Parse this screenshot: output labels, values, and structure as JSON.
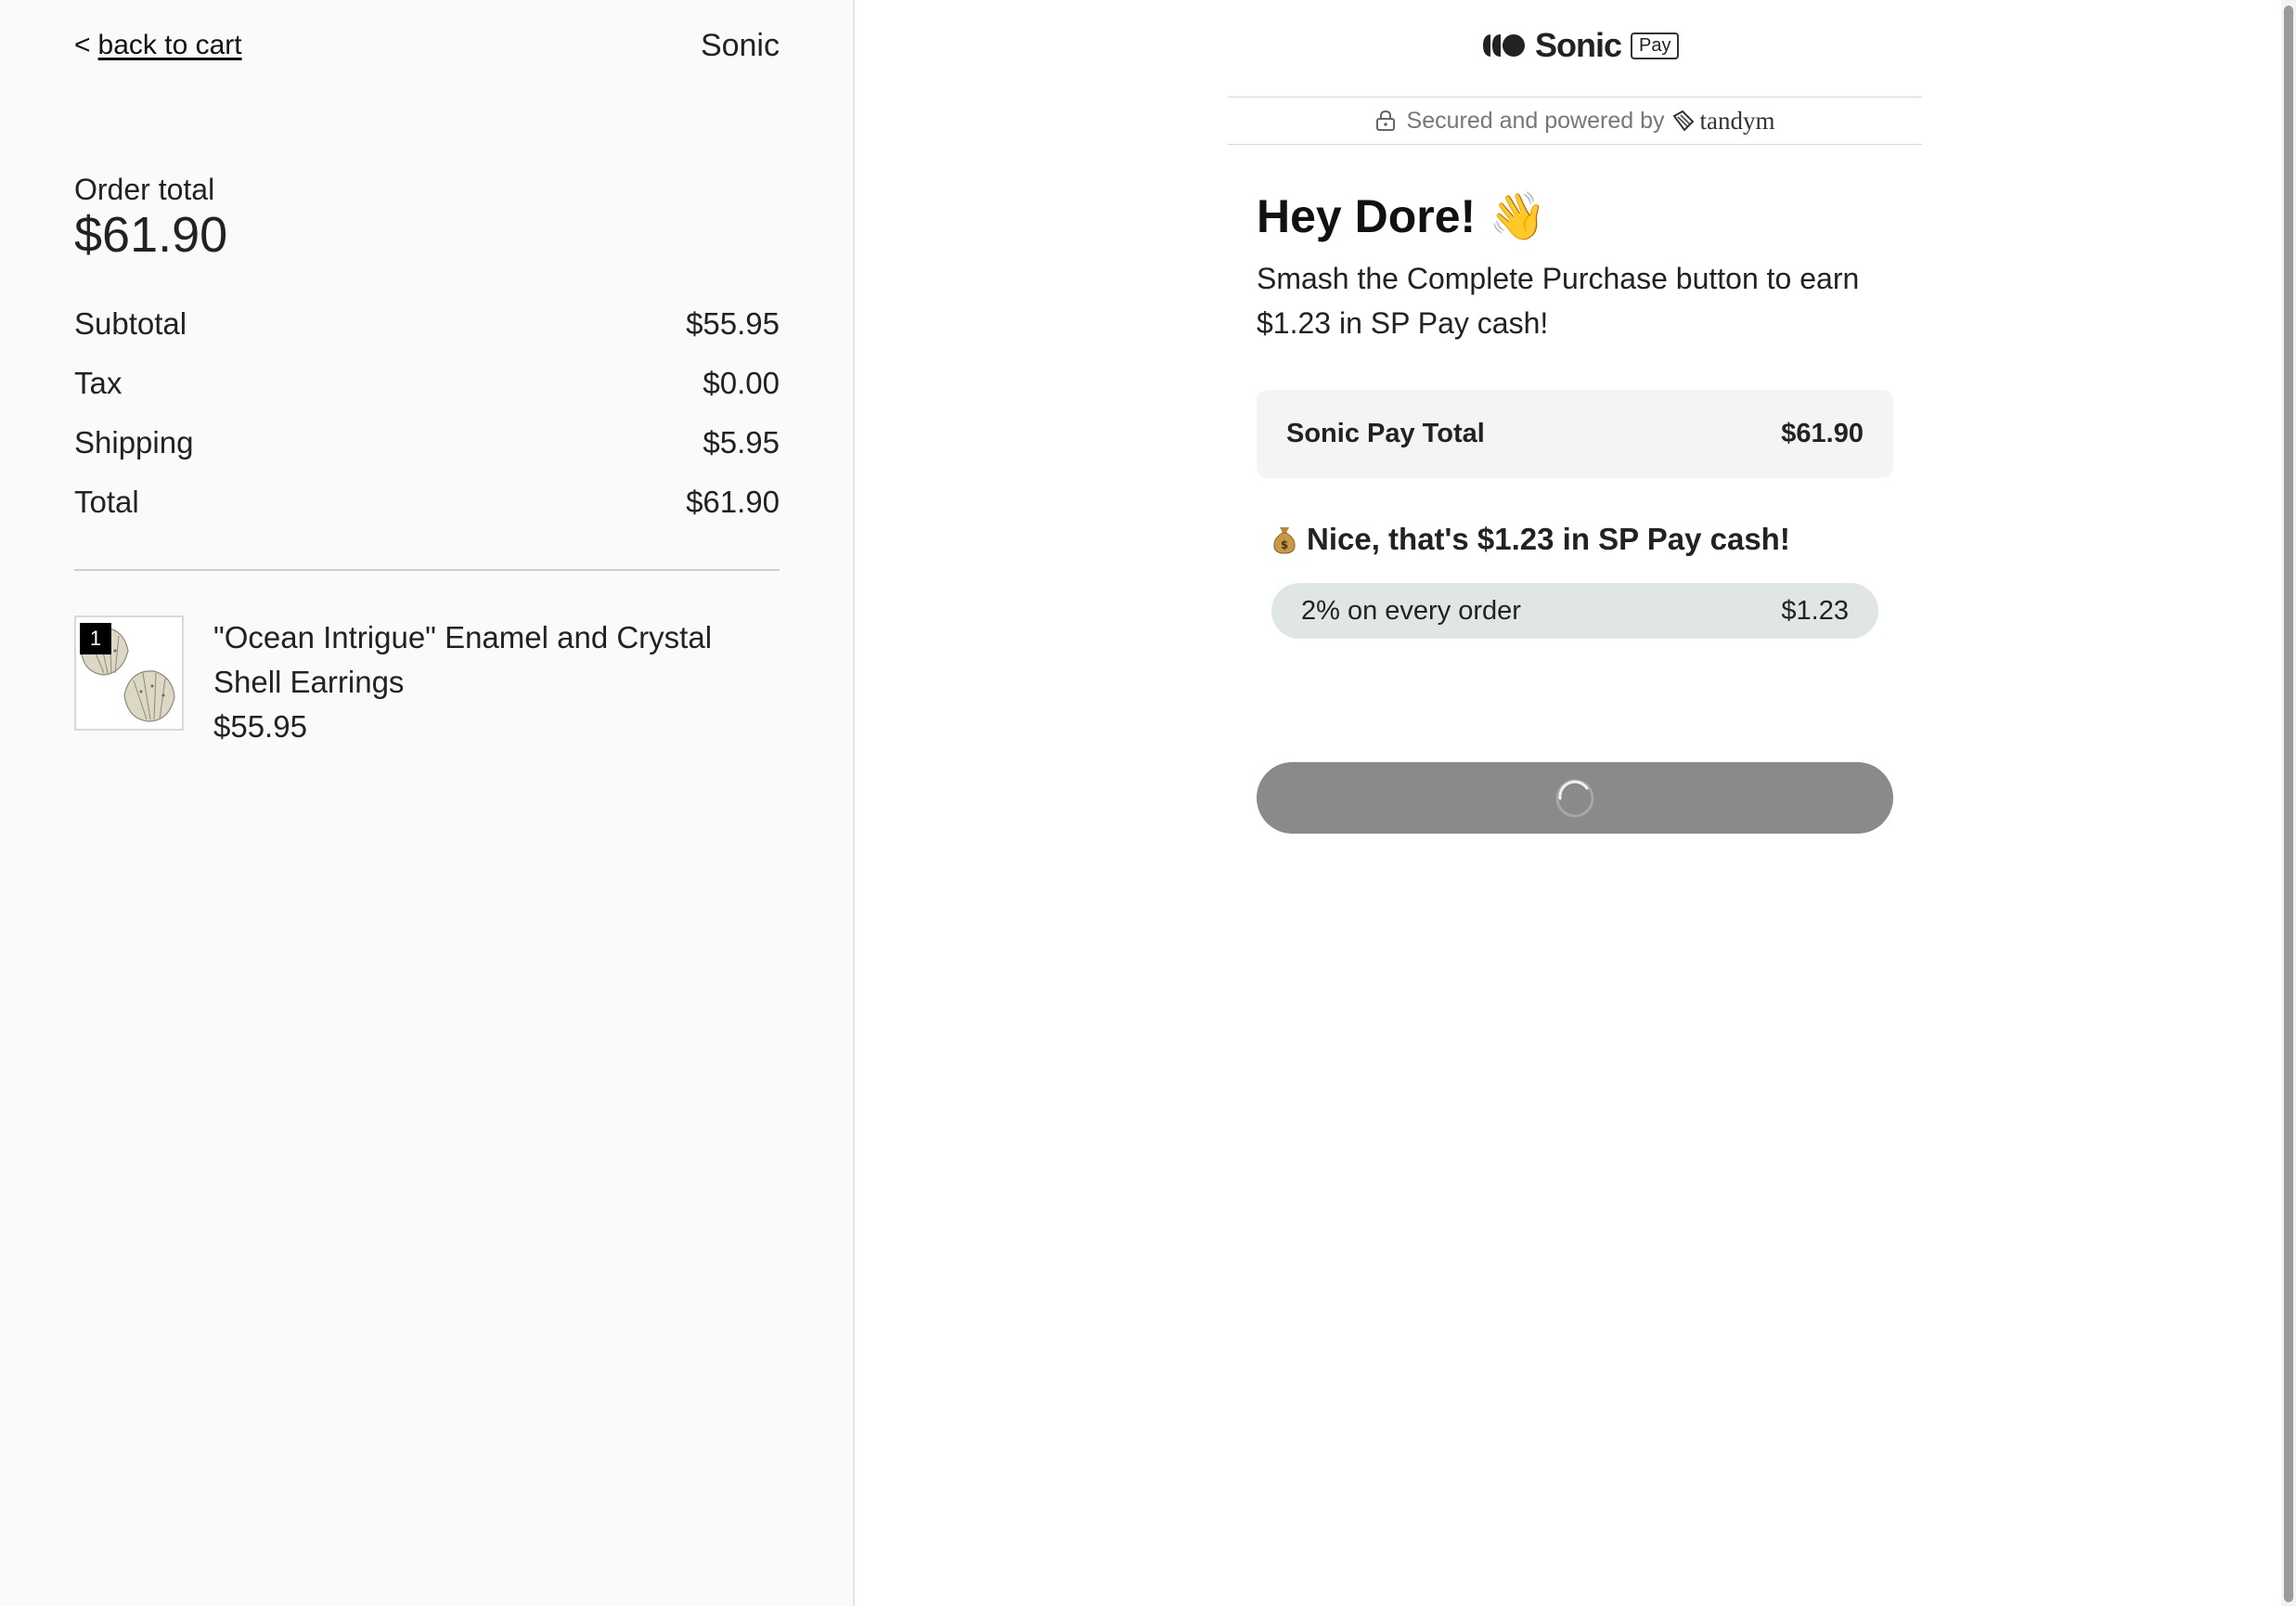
{
  "left": {
    "back_prefix": "<",
    "back_label": "back to cart",
    "store_name": "Sonic",
    "order_total_label": "Order total",
    "order_total_value": "$61.90",
    "summary": [
      {
        "label": "Subtotal",
        "value": "$55.95"
      },
      {
        "label": "Tax",
        "value": "$0.00"
      },
      {
        "label": "Shipping",
        "value": "$5.95"
      },
      {
        "label": "Total",
        "value": "$61.90"
      }
    ],
    "item": {
      "quantity": "1",
      "name": "\"Ocean Intrigue\" Enamel and Crystal Shell Earrings",
      "price": "$55.95"
    }
  },
  "right": {
    "brand_name": "Sonic",
    "pay_tag": "Pay",
    "secured_text": "Secured and powered by",
    "partner_name": "tandym",
    "greeting": "Hey Dore! 👋",
    "subtext": "Smash the Complete Purchase button to earn $1.23 in SP Pay cash!",
    "total_card": {
      "label": "Sonic Pay Total",
      "value": "$61.90"
    },
    "cash_heading": "Nice, that's $1.23 in SP Pay cash!",
    "cash_pill": {
      "label": "2% on every order",
      "value": "$1.23"
    },
    "button_state": "loading"
  },
  "icons": {
    "lock": "lock-icon",
    "brand_logo": "sonic-logo-icon",
    "partner_logo": "tandym-logo-icon",
    "money_bag": "money-bag-icon",
    "spinner": "loading-spinner-icon"
  },
  "colors": {
    "left_bg": "#fafafa",
    "card_bg": "#f4f4f4",
    "pill_bg": "#dfe6e5",
    "button_bg": "#8a8a8a"
  }
}
